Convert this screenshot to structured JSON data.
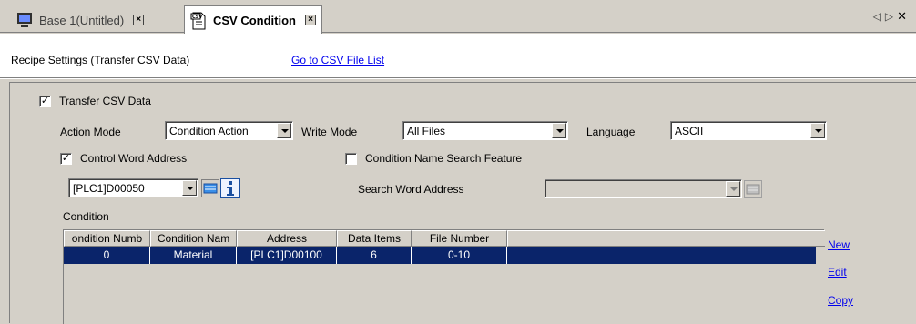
{
  "tabs": [
    {
      "label": "Base 1(Untitled)",
      "active": false
    },
    {
      "label": "CSV Condition",
      "active": true
    }
  ],
  "tab_nav": {
    "prev": "◁",
    "next": "▷",
    "close": "✕"
  },
  "header": {
    "title": "Recipe Settings (Transfer CSV Data)",
    "link": "Go to CSV File List"
  },
  "transfer_csv": {
    "label": "Transfer CSV Data",
    "checked": true
  },
  "action_mode": {
    "label": "Action Mode",
    "value": "Condition Action"
  },
  "write_mode": {
    "label": "Write Mode",
    "value": "All Files"
  },
  "language": {
    "label": "Language",
    "value": "ASCII"
  },
  "control_word": {
    "label": "Control Word Address",
    "checked": true,
    "value": "[PLC1]D00050"
  },
  "condition_search": {
    "label": "Condition Name Search Feature",
    "checked": false
  },
  "search_word": {
    "label": "Search Word Address",
    "value": ""
  },
  "condition": {
    "label": "Condition",
    "columns": [
      "ondition Numb",
      "Condition Nam",
      "Address",
      "Data Items",
      "File Number"
    ],
    "rows": [
      [
        "0",
        "Material",
        "[PLC1]D00100",
        "6",
        "0-10"
      ]
    ]
  },
  "actions": {
    "new": "New",
    "edit": "Edit",
    "copy": "Copy"
  },
  "colors": {
    "selection": "#0a246a",
    "link": "#0000ee",
    "face": "#d4d0c8"
  }
}
